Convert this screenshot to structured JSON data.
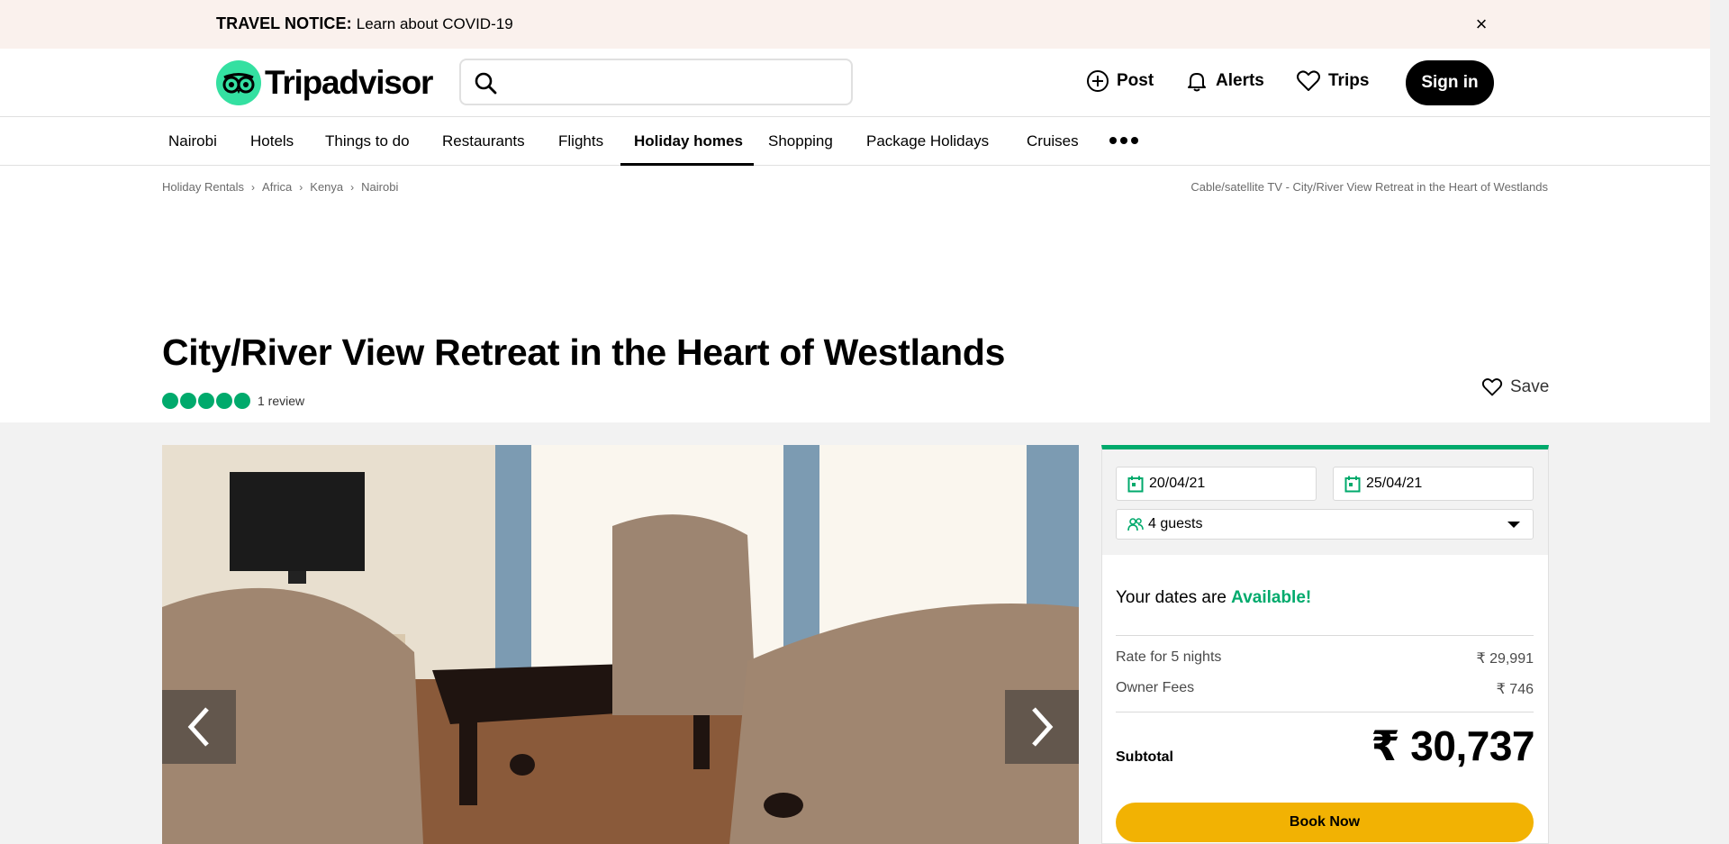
{
  "notice": {
    "label": "TRAVEL NOTICE:",
    "link": "Learn about COVID-19",
    "close": "×"
  },
  "header": {
    "logo": "Tripadvisor",
    "search_placeholder": "",
    "links": [
      {
        "label": "Post",
        "icon": "plus-circle-icon"
      },
      {
        "label": "Alerts",
        "icon": "bell-icon"
      },
      {
        "label": "Trips",
        "icon": "heart-icon"
      }
    ],
    "signin": "Sign in"
  },
  "nav": {
    "items": [
      "Nairobi",
      "Hotels",
      "Things to do",
      "Restaurants",
      "Flights",
      "Holiday homes",
      "Shopping",
      "Package Holidays",
      "Cruises"
    ],
    "active": "Holiday homes"
  },
  "breadcrumb": {
    "items": [
      "Holiday Rentals",
      "Africa",
      "Kenya",
      "Nairobi"
    ],
    "right": "Cable/satellite TV - City/River View Retreat in the Heart of Westlands"
  },
  "listing": {
    "title": "City/River View Retreat in the Heart of Westlands",
    "rating": 5,
    "reviews": "1 review",
    "save": "Save"
  },
  "booking": {
    "check_in": "20/04/21",
    "check_out": "25/04/21",
    "guests": "4 guests",
    "avail_prefix": "Your dates are",
    "avail_status": "Available!",
    "rate_label": "Rate for 5 nights",
    "rate_value": "₹ 29,991",
    "fees_label": "Owner Fees",
    "fees_value": "₹ 746",
    "subtotal_label": "Subtotal",
    "subtotal_value": "₹ 30,737",
    "book": "Book Now"
  },
  "colors": {
    "brand_green": "#34e0a1",
    "rating_green": "#00aa6c",
    "book_yellow": "#f2b203",
    "notice_bg": "#faf1ed"
  }
}
